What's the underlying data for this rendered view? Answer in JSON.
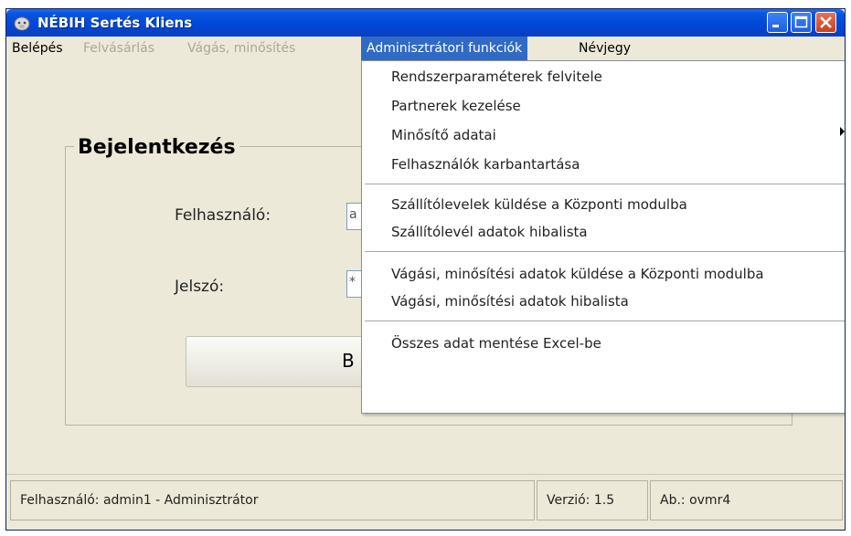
{
  "window": {
    "title": "NÉBIH Sertés Kliens"
  },
  "menubar": {
    "items": [
      {
        "label": "Belépés",
        "state": "normal"
      },
      {
        "label": "Felvásárlás",
        "state": "disabled"
      },
      {
        "label": "Vágás, minősítés",
        "state": "disabled"
      },
      {
        "label": "Adminisztrátori funkciók",
        "state": "active"
      },
      {
        "label": "Névjegy",
        "state": "normal"
      }
    ]
  },
  "login": {
    "group_title": "Bejelentkezés",
    "user_label": "Felhasználó:",
    "user_value": "a",
    "password_label": "Jelszó:",
    "password_value": "*",
    "button_label": "B"
  },
  "dropdown": {
    "items": [
      {
        "label": "Rendszerparaméterek felvitele"
      },
      {
        "label": "Partnerek kezelése",
        "submenu": true
      },
      {
        "label": "Minősítő adatai"
      },
      {
        "label": "Felhasználók karbantartása"
      },
      {
        "label": "Szállítólevelek küldése a Központi modulba"
      },
      {
        "label": "Szállítólevél adatok hibalista"
      },
      {
        "label": "Vágási, minősítési adatok küldése a Központi modulba"
      },
      {
        "label": "Vágási, minősítési adatok hibalista"
      },
      {
        "label": "Összes adat mentése  Excel-be"
      }
    ]
  },
  "statusbar": {
    "user": "Felhasználó: admin1 - Adminisztrátor",
    "version": "Verzió: 1.5",
    "db": "Ab.: ovmr4"
  },
  "colors": {
    "titlebar": "#0048d8",
    "menu_highlight": "#316ac5",
    "close_button": "#c8401e",
    "window_bg": "#ece9d8"
  }
}
